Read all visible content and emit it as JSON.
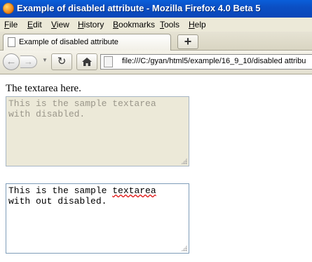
{
  "window": {
    "title": "Example of disabled attribute - Mozilla Firefox 4.0 Beta 5"
  },
  "menu": {
    "items": [
      {
        "label": "File",
        "accel": "F",
        "rest": "ile"
      },
      {
        "label": "Edit",
        "accel": "E",
        "rest": "dit"
      },
      {
        "label": "View",
        "accel": "V",
        "rest": "iew"
      },
      {
        "label": "History",
        "accel": "H",
        "rest": "istory"
      },
      {
        "label": "Bookmarks",
        "accel": "B",
        "rest": "ookmarks"
      },
      {
        "label": "Tools",
        "accel": "T",
        "rest": "ools"
      },
      {
        "label": "Help",
        "accel": "H",
        "rest": "elp"
      }
    ]
  },
  "tabs": {
    "active_title": "Example of disabled attribute",
    "new_tab_label": "+"
  },
  "nav": {
    "back_icon": "back-arrow-icon",
    "forward_icon": "forward-arrow-icon",
    "reload_icon": "reload-icon",
    "home_icon": "home-icon",
    "url": "file:///C:/gyan/html5/example/16_9_10/disabled attribu"
  },
  "content": {
    "label": "The textarea here.",
    "disabled_textarea": {
      "line1": "This is the sample textarea",
      "line2": "with disabled."
    },
    "enabled_textarea": {
      "line1_prefix": "This is the sample ",
      "line1_misspelled": "textarea",
      "line2": "with out disabled."
    }
  },
  "colors": {
    "titlebar": "#0a4fc4",
    "chrome": "#ece9d8",
    "disabled_bg": "#ece9d8",
    "disabled_text": "#9a968a",
    "textarea_border": "#7f9db9"
  }
}
